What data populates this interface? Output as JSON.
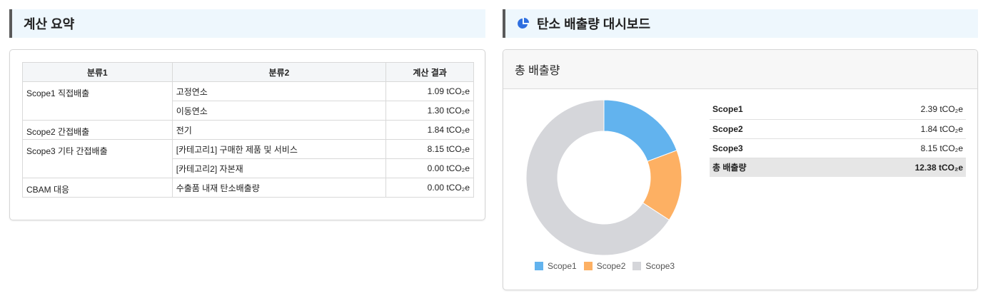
{
  "left_panel": {
    "title": "계산 요약",
    "columns": [
      "분류1",
      "분류2",
      "계산 결과"
    ],
    "rows": [
      {
        "cat1": "Scope1 직접배출",
        "cat2": "고정연소",
        "result": "1.09 tCO₂e"
      },
      {
        "cat1": "",
        "cat2": "이동연소",
        "result": "1.30 tCO₂e"
      },
      {
        "cat1": "Scope2 간접배출",
        "cat2": "전기",
        "result": "1.84 tCO₂e"
      },
      {
        "cat1": "Scope3 기타 간접배출",
        "cat2": "[카테고리1] 구매한 제품 및 서비스",
        "result": "8.15 tCO₂e"
      },
      {
        "cat1": "",
        "cat2": "[카테고리2] 자본재",
        "result": "0.00 tCO₂e"
      },
      {
        "cat1": "CBAM 대응",
        "cat2": "수출품 내재 탄소배출량",
        "result": "0.00 tCO₂e"
      }
    ]
  },
  "right_panel": {
    "title": "탄소 배출량 대시보드",
    "icon": "pie-chart-icon",
    "card_title": "총 배출량",
    "totals": [
      {
        "label": "Scope1",
        "value": "2.39 tCO₂e"
      },
      {
        "label": "Scope2",
        "value": "1.84 tCO₂e"
      },
      {
        "label": "Scope3",
        "value": "8.15 tCO₂e"
      },
      {
        "label": "총 배출량",
        "value": "12.38 tCO₂e"
      }
    ]
  },
  "colors": {
    "accent_blue": "#2f6fe0",
    "scope1": "#62b3ee",
    "scope2": "#fdb063",
    "scope3": "#d5d6da"
  },
  "chart_data": {
    "type": "pie",
    "variant": "donut",
    "categories": [
      "Scope1",
      "Scope2",
      "Scope3"
    ],
    "values": [
      2.39,
      1.84,
      8.15
    ],
    "colors": [
      "#62b3ee",
      "#fdb063",
      "#d5d6da"
    ],
    "legend_position": "bottom"
  }
}
